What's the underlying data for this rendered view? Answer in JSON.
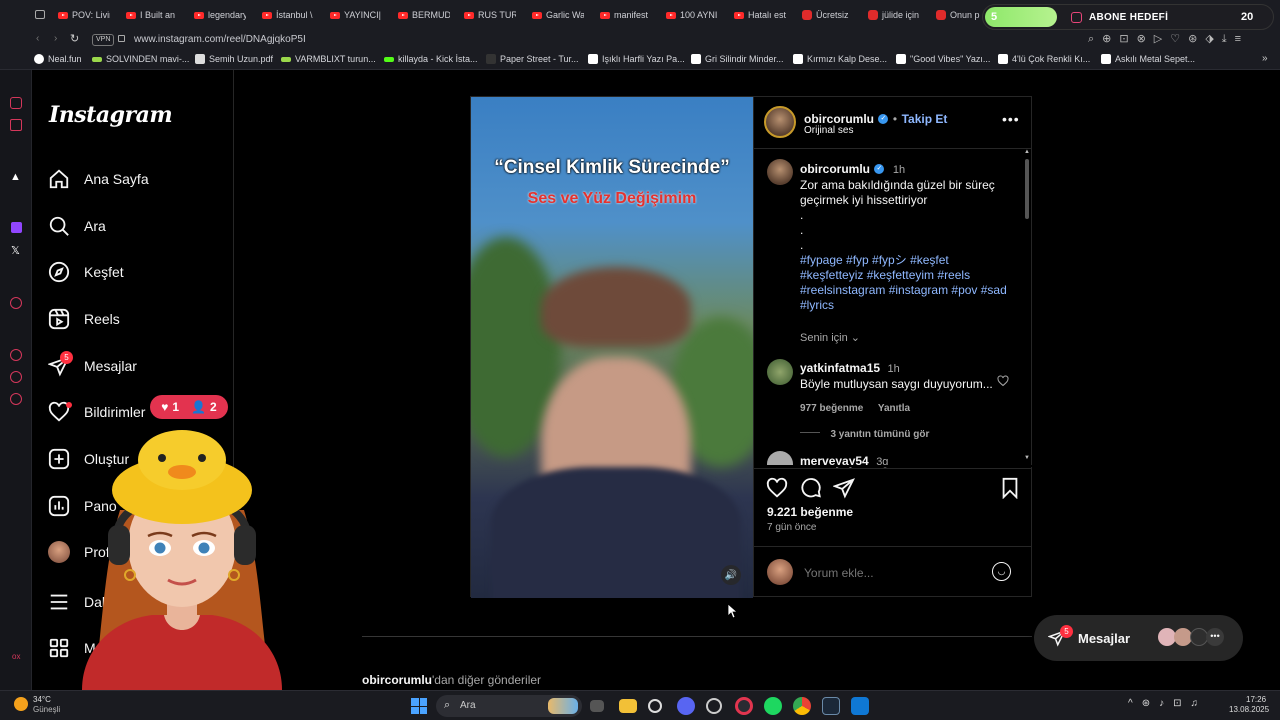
{
  "browser": {
    "tabs": [
      {
        "label": "POV: Livin",
        "icon": "youtube-icon"
      },
      {
        "label": "I Built an",
        "icon": "youtube-icon"
      },
      {
        "label": "legendary",
        "icon": "youtube-icon"
      },
      {
        "label": "İstanbul \\",
        "icon": "youtube-icon"
      },
      {
        "label": "YAYINCI|",
        "icon": "youtube-icon"
      },
      {
        "label": "BERMUDA",
        "icon": "youtube-icon"
      },
      {
        "label": "RUS TUR",
        "icon": "youtube-icon"
      },
      {
        "label": "Garlic Wa",
        "icon": "youtube-icon"
      },
      {
        "label": "manifest",
        "icon": "youtube-icon"
      },
      {
        "label": "100 AYNI",
        "icon": "youtube-icon"
      },
      {
        "label": "Hatalı est",
        "icon": "youtube-icon"
      },
      {
        "label": "Ücretsiz",
        "icon": "pinterest-icon"
      },
      {
        "label": "jülide için",
        "icon": "pinterest-icon"
      },
      {
        "label": "Onun p",
        "icon": "pinterest-icon"
      }
    ],
    "url": "www.instagram.com/reel/DNAgjqkoP5I",
    "vpn_label": "VPN",
    "bookmarks": [
      "Neal.fun",
      "SOLVINDEN mavi-...",
      "Semih Uzun.pdf",
      "VARMBLIXT turun...",
      "killayda - Kick İsta...",
      "Paper Street - Tur...",
      "Işıklı Harfli Yazı Pa...",
      "Gri Silindir Minder...",
      "Kırmızı Kalp Dese...",
      "\"Good Vibes\" Yazı...",
      "4'lü Çok Renkli Kı...",
      "Askılı Metal Sepet..."
    ]
  },
  "overlay": {
    "goal_left": "5",
    "goal_label": "ABONE HEDEFİ",
    "goal_right": "20",
    "goal_progress": 0.25,
    "hearts": "1",
    "people": "2"
  },
  "instagram": {
    "logo": "Instagram",
    "nav": [
      {
        "label": "Ana Sayfa",
        "icon": "home-icon"
      },
      {
        "label": "Ara",
        "icon": "search-icon"
      },
      {
        "label": "Keşfet",
        "icon": "compass-icon"
      },
      {
        "label": "Reels",
        "icon": "reels-icon"
      },
      {
        "label": "Mesajlar",
        "icon": "messenger-icon",
        "badge": "5"
      },
      {
        "label": "Bildirimler",
        "icon": "heart-icon"
      },
      {
        "label": "Oluştur",
        "icon": "plus-icon"
      },
      {
        "label": "Pano",
        "icon": "dashboard-icon"
      },
      {
        "label": "Profil",
        "icon": "profile-icon"
      },
      {
        "label": "Daha",
        "icon": "menu-icon"
      },
      {
        "label": "Meta",
        "icon": "meta-icon"
      }
    ],
    "post": {
      "video_title": "“Cinsel Kimlik Sürecinde”",
      "video_subtitle": "Ses ve Yüz Değişimim",
      "author": "obircorumlu",
      "follow_label": "Takip Et",
      "audio": "Orijinal ses",
      "caption_time": "1h",
      "caption_line1": "Zor ama bakıldığında güzel bir süreç",
      "caption_line2": "geçirmek iyi hissettiriyor",
      "dots": ".",
      "hashtags_1": "#fypage #fyp #fypシ #keşfet",
      "hashtags_2": "#keşfetteyiz #keşfetteyim #reels",
      "hashtags_3": "#reelsinstagram #instagram #pov #sad",
      "hashtags_4": "#lyrics",
      "for_you": "Senin için",
      "comments": [
        {
          "user": "yatkinfatma15",
          "time": "1h",
          "text": "Böyle mutluysan saygı duyuyorum...",
          "likes": "977 beğenme",
          "reply": "Yanıtla",
          "view_replies": "3 yanıtın tümünü gör"
        },
        {
          "user": "merveyay54",
          "time": "3g"
        }
      ],
      "likes": "9.221 beğenme",
      "date": "7 gün önce",
      "comment_placeholder": "Yorum ekle..."
    },
    "more_from_user": "obircorumlu",
    "more_from_suffix": "'dan diğer gönderiler",
    "messages_pill": {
      "label": "Mesajlar",
      "badge": "5"
    }
  },
  "taskbar": {
    "weather_temp": "34°C",
    "weather_desc": "Güneşli",
    "search": "Ara",
    "time": "17:26",
    "date": "13.08.2025"
  },
  "colors": {
    "accent": "#0095f6",
    "badge": "#ff3040",
    "follow": "#8fb8ff"
  }
}
